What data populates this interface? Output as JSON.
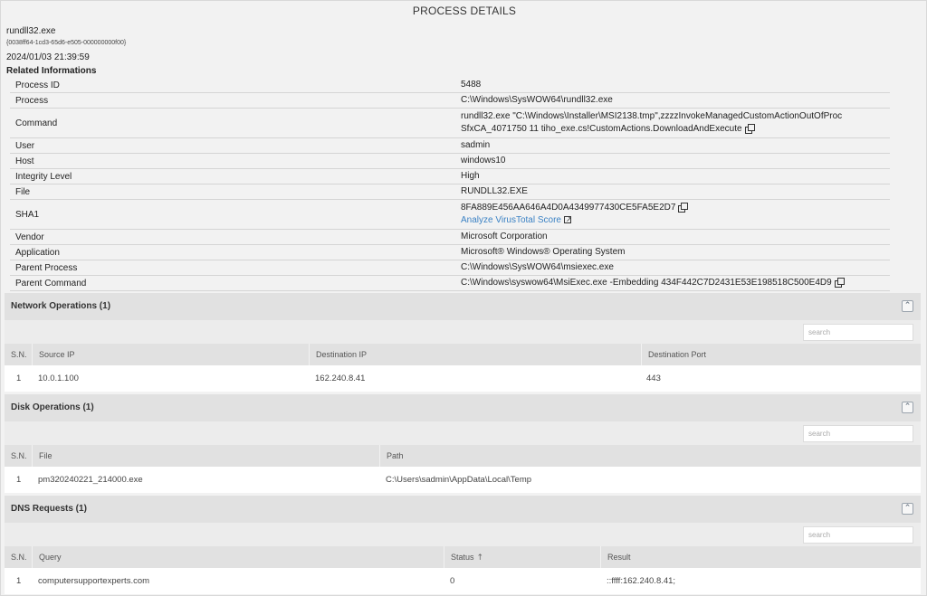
{
  "header": {
    "title": "PROCESS DETAILS"
  },
  "process": {
    "name": "rundll32.exe",
    "guid": "{0038ff64-1cd3-65d6-e505-000000000f00}",
    "timestamp": "2024/01/03 21:39:59"
  },
  "related": {
    "title": "Related Informations",
    "rows": [
      {
        "key": "Process ID",
        "value": "5488"
      },
      {
        "key": "Process",
        "value": "C:\\Windows\\SysWOW64\\rundll32.exe"
      },
      {
        "key": "Command",
        "value": "rundll32.exe \"C:\\Windows\\Installer\\MSI2138.tmp\",zzzzInvokeManagedCustomActionOutOfProc",
        "value2": "SfxCA_4071750 11 tiho_exe.cs!CustomActions.DownloadAndExecute"
      },
      {
        "key": "User",
        "value": "sadmin"
      },
      {
        "key": "Host",
        "value": "windows10"
      },
      {
        "key": "Integrity Level",
        "value": "High"
      },
      {
        "key": "File",
        "value": "RUNDLL32.EXE"
      },
      {
        "key": "SHA1",
        "value": "8FA889E456AA646A4D0A4349977430CE5FA5E2D7",
        "link": "Analyze VirusTotal Score"
      },
      {
        "key": "Vendor",
        "value": "Microsoft Corporation"
      },
      {
        "key": "Application",
        "value": "Microsoft® Windows® Operating System"
      },
      {
        "key": "Parent Process",
        "value": "C:\\Windows\\SysWOW64\\msiexec.exe"
      },
      {
        "key": "Parent Command",
        "value": "C:\\Windows\\syswow64\\MsiExec.exe -Embedding 434F442C7D2431E53E198518C500E4D9"
      }
    ]
  },
  "network": {
    "title": "Network Operations (1)",
    "search_placeholder": "search",
    "columns": [
      "S.N.",
      "Source IP",
      "Destination IP",
      "Destination Port"
    ],
    "rows": [
      [
        "1",
        "10.0.1.100",
        "162.240.8.41",
        "443"
      ]
    ]
  },
  "disk": {
    "title": "Disk Operations (1)",
    "search_placeholder": "search",
    "columns": [
      "S.N.",
      "File",
      "Path"
    ],
    "rows": [
      [
        "1",
        "pm320240221_214000.exe",
        "C:\\Users\\sadmin\\AppData\\Local\\Temp"
      ]
    ]
  },
  "dns": {
    "title": "DNS Requests (1)",
    "search_placeholder": "search",
    "columns": [
      "S.N.",
      "Query",
      "Status",
      "Result"
    ],
    "rows": [
      [
        "1",
        "computersupportexperts.com",
        "0",
        "::ffff:162.240.8.41;"
      ]
    ]
  },
  "icons": {
    "copy": "copy-icon",
    "external": "external-link-icon",
    "collapse": "collapse-icon",
    "sort": "sort-arrow-icon"
  },
  "colors": {
    "link": "#3b82c4",
    "section_header": "#e1e1e1",
    "background": "#f2f2f2"
  }
}
